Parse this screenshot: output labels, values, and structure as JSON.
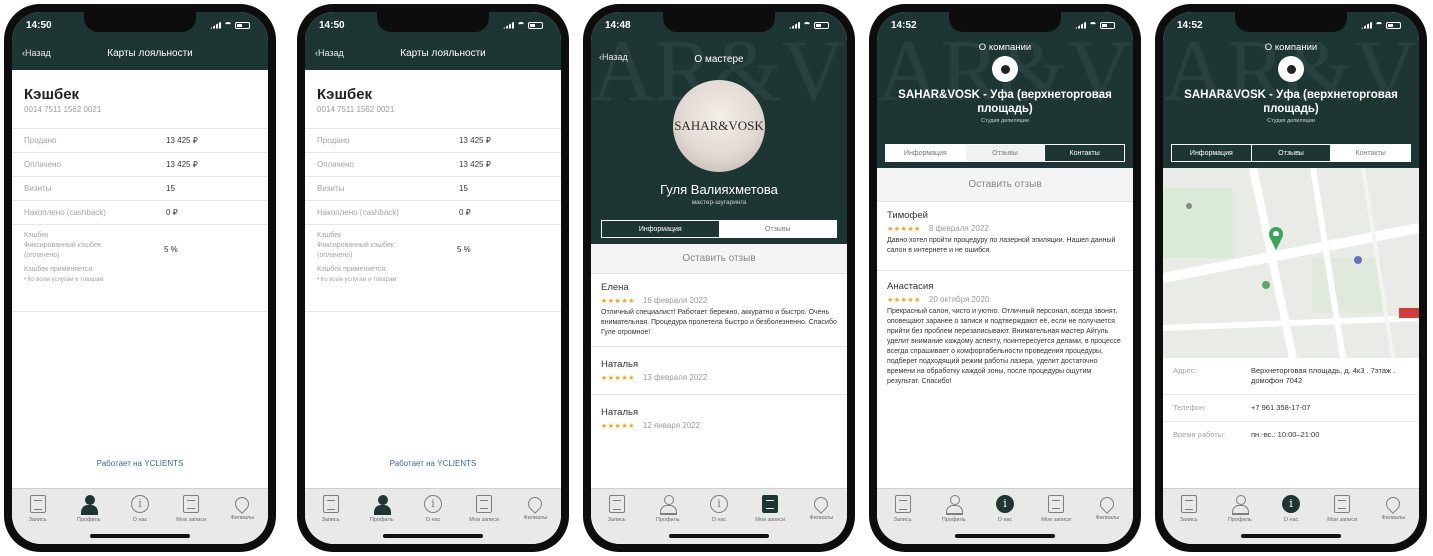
{
  "status_times": [
    "14:50",
    "14:50",
    "14:48",
    "14:52",
    "14:52"
  ],
  "colors": {
    "header": "#1d3634",
    "star": "#f2a323",
    "link": "#3a6a90"
  },
  "loyalty": {
    "back": "‹Назад",
    "title": "Карты лояльности",
    "card_title": "Кэшбек",
    "card_number": "0014 7511 1562 0021",
    "rows": [
      {
        "k": "Продано",
        "v": "13 425 ₽"
      },
      {
        "k": "Оплачено",
        "v": "13 425 ₽"
      },
      {
        "k": "Визиты",
        "v": "15"
      },
      {
        "k": "Накоплено (cashback)",
        "v": "0 ₽"
      }
    ],
    "cashback_label": "Кэшбек",
    "cashback_fixed": "Фиксированный кэшбек",
    "cashback_paid": "(оплачено)",
    "cashback_value": "5 %",
    "applies_label": "Кэшбек применяется:",
    "applies_value": "• Ко всем услугам и товарам",
    "powered": "Работает на YCLIENTS"
  },
  "tabs": [
    "Запись",
    "Профиль",
    "О нас",
    "Мои записи",
    "Филиалы"
  ],
  "master": {
    "back": "‹Назад",
    "title": "О мастере",
    "avatar_text": "SAHAR&VOSK",
    "name": "Гуля Валияхметова",
    "role": "мастер-шугаринга",
    "seg_left": "Информация",
    "seg_right": "Отзывы",
    "write_review": "Оставить отзыв",
    "reviews": [
      {
        "name": "Елена",
        "date": "16 февраля 2022",
        "text": "Отличный специалист! Работает бережно, аккуратно и быстро. Очень внимательная. Процедура пролетела быстро и безболезненно. Спасибо Гуле огромное!"
      },
      {
        "name": "Наталья",
        "date": "13 февраля 2022",
        "text": ""
      },
      {
        "name": "Наталья",
        "date": "12 января 2022",
        "text": ""
      }
    ]
  },
  "company": {
    "title": "О компании",
    "name": "SAHAR&VOSK - Уфа (верхнеторговая площадь)",
    "subtitle": "Студия депиляции",
    "seg": [
      "Информация",
      "Отзывы",
      "Контакты"
    ],
    "write_review": "Оставить отзыв",
    "reviews": [
      {
        "name": "Тимофей",
        "date": "8 февраля 2022",
        "text": "Давно хотел пройти процедуру по лазерной эпиляции. Нашел данный салон в интернете и не ошибся."
      },
      {
        "name": "Анастасия",
        "date": "20 октября 2020",
        "text": "Прекрасный салон, чисто и уютно. Отличный персонал, всегда звонят, оповещают заранее о записи и подтверждают её, если не получается прийти без проблем перезаписывают. Внимательная мастер Айгуль уделит внимание каждому аспекту, поинтересуется делами, в процессе всегда спрашивает о комфортабельности проведения процедуры, подберет подходящий режим работы лазера, уделит достаточно времени на обработку каждой зоны, после процедуры ощутим результат. Спасибо!"
      }
    ],
    "contacts": [
      {
        "k": "Адрес:",
        "v": "Верхнеторговая площадь, д. 4к3 . 7этаж . домофон 7042"
      },
      {
        "k": "Телефон:",
        "v": "+7 961 358-17-07"
      },
      {
        "k": "Время работы:",
        "v": "пн.-вс.: 10:00–21:00"
      }
    ]
  }
}
